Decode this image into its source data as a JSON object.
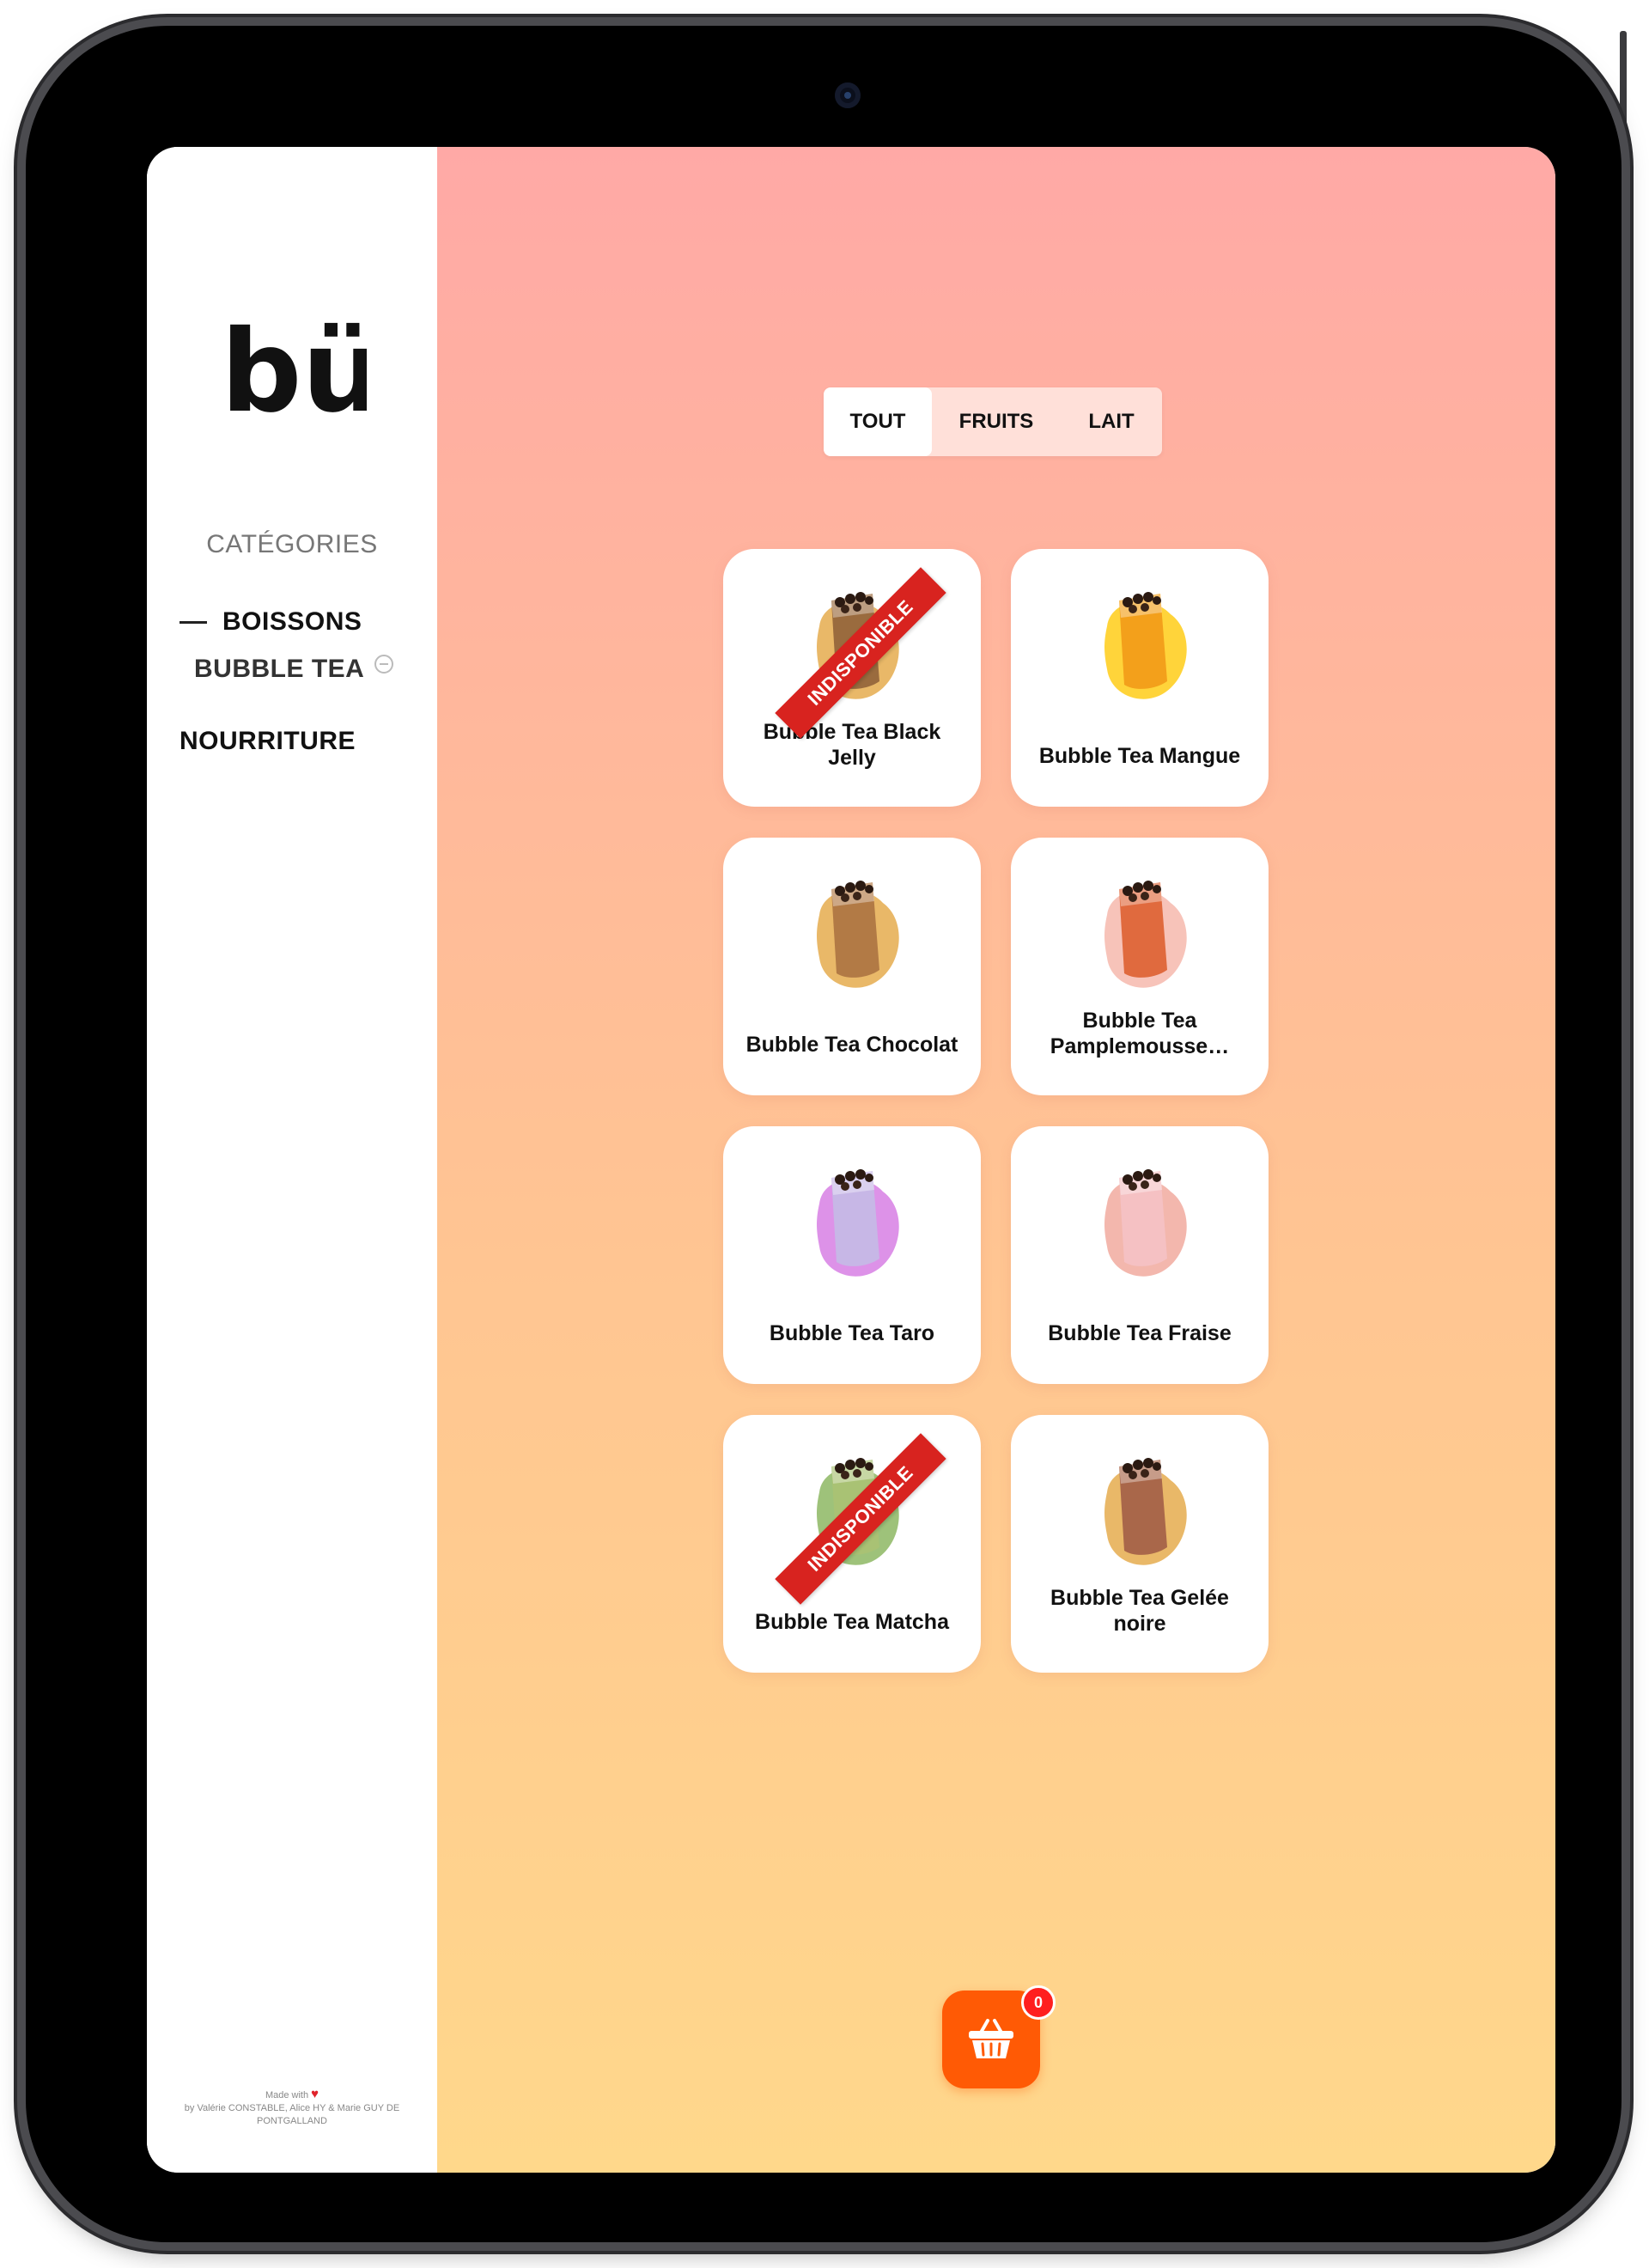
{
  "brand": {
    "logo_text": "bü"
  },
  "sidebar": {
    "categories_title": "CATÉGORIES",
    "items": [
      {
        "label": "BOISSONS",
        "expanded": true
      },
      {
        "label": "BUBBLE TEA",
        "sub": true
      },
      {
        "label": "NOURRITURE"
      }
    ],
    "credits": {
      "made_with": "Made with",
      "heart_icon": "heart-icon",
      "authors": "by Valérie CONSTABLE, Alice HY & Marie GUY DE PONTGALLAND"
    }
  },
  "tabs": [
    {
      "label": "TOUT",
      "active": true
    },
    {
      "label": "FRUITS",
      "active": false
    },
    {
      "label": "LAIT",
      "active": false
    }
  ],
  "unavailable_label": "INDISPONIBLE",
  "products": [
    {
      "name": "Bubble Tea Black Jelly",
      "available": false,
      "cup_color": "#9a6b3e",
      "blob_color": "#e9b868"
    },
    {
      "name": "Bubble Tea Mangue",
      "available": true,
      "cup_color": "#f3a01b",
      "blob_color": "#ffd43a"
    },
    {
      "name": "Bubble Tea Chocolat",
      "available": true,
      "cup_color": "#b27a45",
      "blob_color": "#e9b868"
    },
    {
      "name": "Bubble Tea Pamplemousse…",
      "available": true,
      "cup_color": "#e06a3e",
      "blob_color": "#f7c3b9"
    },
    {
      "name": "Bubble Tea Taro",
      "available": true,
      "cup_color": "#c7b7e6",
      "blob_color": "#dd92e8"
    },
    {
      "name": "Bubble Tea Fraise",
      "available": true,
      "cup_color": "#f5c1c3",
      "blob_color": "#f3b7ad"
    },
    {
      "name": "Bubble Tea Matcha",
      "available": false,
      "cup_color": "#a9c274",
      "blob_color": "#9ec27a"
    },
    {
      "name": "Bubble Tea Gelée noire",
      "available": true,
      "cup_color": "#a9674a",
      "blob_color": "#e9b868"
    }
  ],
  "cart": {
    "count": "0",
    "icon": "basket-icon"
  },
  "colors": {
    "accent": "#ff5a05",
    "ribbon": "#d8231f",
    "gradient_top": "#ffa9a6",
    "gradient_bottom": "#ffd88b"
  }
}
